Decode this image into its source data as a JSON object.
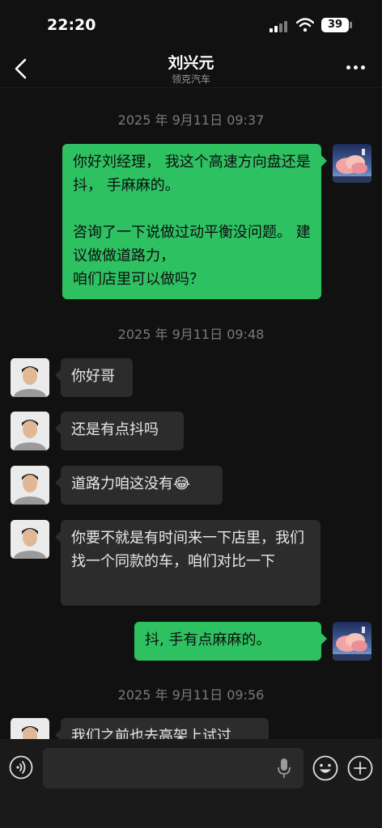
{
  "status_bar": {
    "time": "22:20",
    "battery": "39"
  },
  "header": {
    "title": "刘兴元",
    "subtitle": "领克汽车"
  },
  "messages": [
    {
      "type": "timestamp",
      "text": "2025 年 9月11日 09:37"
    },
    {
      "type": "sent",
      "text": "你好刘经理，   我这个高速方向盘还是抖，  手麻麻的。\n\n咨询了一下说做过动平衡没问题。   建议做做道路力，\n咱们店里可以做吗？"
    },
    {
      "type": "timestamp",
      "text": "2025 年 9月11日 09:48"
    },
    {
      "type": "received",
      "text": "你好哥"
    },
    {
      "type": "received",
      "text": "还是有点抖吗"
    },
    {
      "type": "received",
      "text": "道路力咱这没有😂"
    },
    {
      "type": "received",
      "text": "你要不就是有时间来一下店里，我们找一个同款的车，咱们对比一下"
    },
    {
      "type": "sent",
      "text": "抖,      手有点麻麻的。"
    },
    {
      "type": "timestamp",
      "text": "2025 年 9月11日 09:56"
    },
    {
      "type": "received",
      "text": "我们之前也去高架上试过"
    }
  ],
  "input_bar": {
    "placeholder": ""
  },
  "icons": {
    "back": "chevron-left-icon",
    "more": "more-dots-icon",
    "voice": "voice-icon",
    "mic": "microphone-icon",
    "emoji": "emoji-icon",
    "plus": "plus-icon"
  },
  "colors": {
    "sent_bubble": "#2ec162",
    "received_bubble": "#2c2c2c",
    "background": "#111111"
  }
}
